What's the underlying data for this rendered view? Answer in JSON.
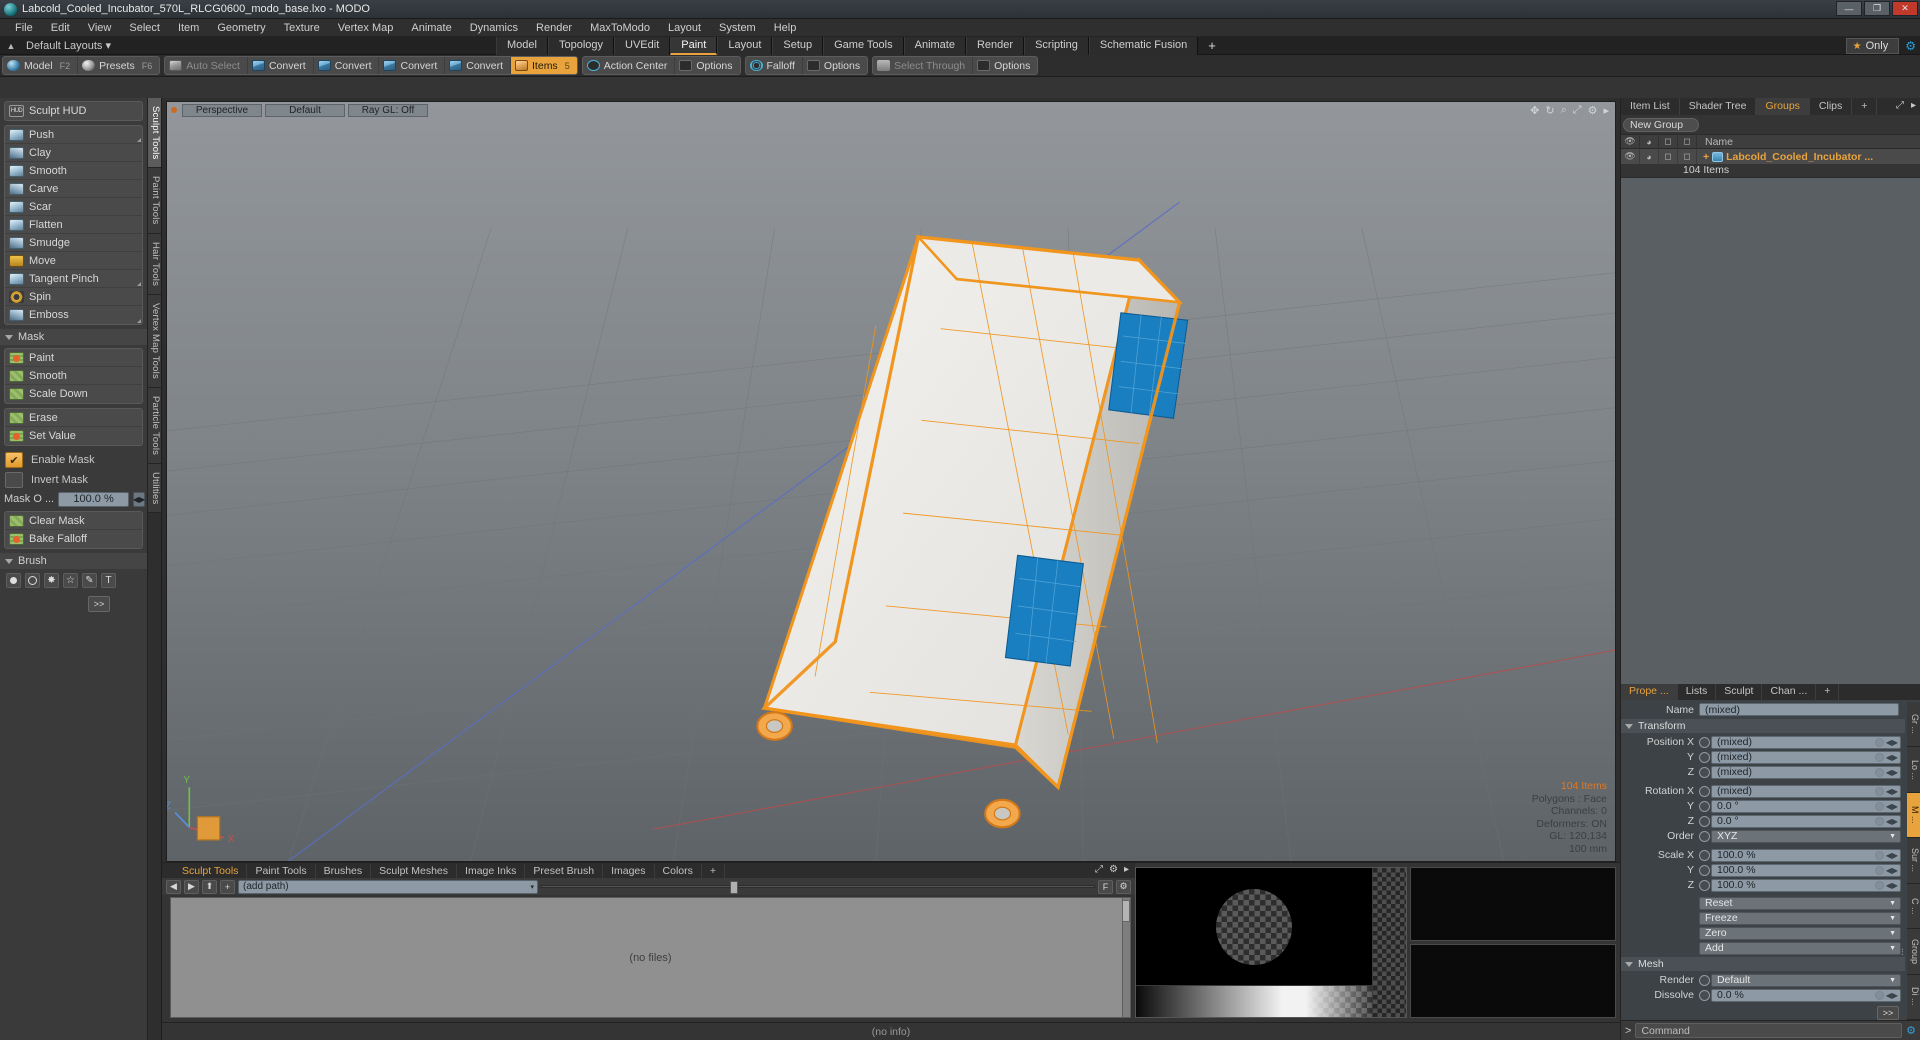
{
  "window": {
    "title": "Labcold_Cooled_Incubator_570L_RLCG0600_modo_base.lxo - MODO",
    "minimize": "—",
    "maximize": "❐",
    "close": "✕"
  },
  "menubar": {
    "items": [
      "File",
      "Edit",
      "View",
      "Select",
      "Item",
      "Geometry",
      "Texture",
      "Vertex Map",
      "Animate",
      "Dynamics",
      "Render",
      "MaxToModo",
      "Layout",
      "System",
      "Help"
    ]
  },
  "layoutbar": {
    "home_icon": "▲",
    "layouts_label": "Default Layouts ▾",
    "tabs": [
      {
        "label": "Model",
        "active": false
      },
      {
        "label": "Topology",
        "active": false
      },
      {
        "label": "UVEdit",
        "active": false
      },
      {
        "label": "Paint",
        "active": true
      },
      {
        "label": "Layout",
        "active": false
      },
      {
        "label": "Setup",
        "active": false
      },
      {
        "label": "Game Tools",
        "active": false
      },
      {
        "label": "Animate",
        "active": false
      },
      {
        "label": "Render",
        "active": false
      },
      {
        "label": "Scripting",
        "active": false
      },
      {
        "label": "Schematic Fusion",
        "active": false
      }
    ],
    "add_tab": "+",
    "only_label": "Only",
    "star_icon": "★",
    "gear_icon": "⚙"
  },
  "modebar": {
    "groups": [
      {
        "buttons": [
          {
            "label": "Model",
            "key": "F2",
            "icon": "sphere-icon",
            "state": "normal"
          },
          {
            "label": "Presets",
            "key": "F6",
            "icon": "presets-icon",
            "state": "normal"
          }
        ]
      },
      {
        "buttons": [
          {
            "label": "Auto Select",
            "key": "",
            "icon": "cube-gray-icon",
            "state": "dim"
          },
          {
            "label": "Convert",
            "key": "",
            "icon": "cube-icon",
            "state": "normal"
          },
          {
            "label": "Convert",
            "key": "",
            "icon": "cube-icon",
            "state": "normal"
          },
          {
            "label": "Convert",
            "key": "",
            "icon": "cube-icon",
            "state": "normal"
          },
          {
            "label": "Convert",
            "key": "",
            "icon": "cube-icon",
            "state": "normal"
          },
          {
            "label": "Items",
            "key": "5",
            "icon": "cube-orange-icon",
            "state": "active"
          }
        ]
      },
      {
        "buttons": [
          {
            "label": "Action Center",
            "key": "",
            "icon": "target-icon",
            "state": "normal"
          },
          {
            "label": "Options",
            "key": "",
            "icon": "checkbox-icon",
            "state": "normal"
          }
        ]
      },
      {
        "buttons": [
          {
            "label": "Falloff",
            "key": "",
            "icon": "falloff-icon",
            "state": "normal"
          },
          {
            "label": "Options",
            "key": "",
            "icon": "checkbox-icon",
            "state": "normal"
          }
        ]
      },
      {
        "buttons": [
          {
            "label": "Select Through",
            "key": "",
            "icon": "people-icon",
            "state": "dim"
          },
          {
            "label": "Options",
            "key": "",
            "icon": "checkbox-icon",
            "state": "normal"
          }
        ]
      }
    ]
  },
  "left_panel": {
    "hud": {
      "label": "Sculpt HUD",
      "icon": "hud-icon"
    },
    "sculpt_tools": [
      {
        "label": "Push",
        "icon": "brush-push-icon",
        "corner": true
      },
      {
        "label": "Clay",
        "icon": "brush-clay-icon",
        "corner": false
      },
      {
        "label": "Smooth",
        "icon": "brush-smooth-icon",
        "corner": false
      },
      {
        "label": "Carve",
        "icon": "brush-carve-icon",
        "corner": false
      },
      {
        "label": "Scar",
        "icon": "brush-scar-icon",
        "corner": false
      },
      {
        "label": "Flatten",
        "icon": "brush-flatten-icon",
        "corner": false
      },
      {
        "label": "Smudge",
        "icon": "brush-smudge-icon",
        "corner": false
      },
      {
        "label": "Move",
        "icon": "brush-move-icon",
        "corner": false
      },
      {
        "label": "Tangent Pinch",
        "icon": "brush-tangent-pinch-icon",
        "corner": true
      },
      {
        "label": "Spin",
        "icon": "brush-spin-icon",
        "corner": false
      },
      {
        "label": "Emboss",
        "icon": "brush-emboss-icon",
        "corner": true
      }
    ],
    "mask_section": "Mask",
    "mask_tools": [
      {
        "label": "Paint",
        "icon": "mask-paint-icon"
      },
      {
        "label": "Smooth",
        "icon": "mask-smooth-icon"
      },
      {
        "label": "Scale Down",
        "icon": "mask-scale-down-icon"
      }
    ],
    "mask_tools2": [
      {
        "label": "Erase",
        "icon": "mask-erase-icon"
      },
      {
        "label": "Set Value",
        "icon": "mask-set-value-icon"
      }
    ],
    "enable_mask": {
      "label": "Enable Mask",
      "checked": true,
      "check_glyph": "✔"
    },
    "invert_mask": {
      "label": "Invert Mask",
      "checked": false
    },
    "mask_opacity": {
      "label": "Mask O  ...",
      "value": "100.0 %",
      "spin": "◀▶"
    },
    "mask_actions": [
      {
        "label": "Clear Mask",
        "icon": "mask-clear-icon"
      },
      {
        "label": "Bake Falloff",
        "icon": "mask-bake-icon"
      }
    ],
    "brush_section": "Brush",
    "brush_icons": [
      "brush-dot-icon",
      "brush-ring-icon",
      "brush-spray-icon",
      "brush-star-icon",
      "brush-pen-icon",
      "brush-text-icon"
    ],
    "more_button": ">>",
    "vtabs": [
      {
        "label": "Sculpt Tools",
        "active": true
      },
      {
        "label": "Paint Tools",
        "active": false
      },
      {
        "label": "Hair Tools",
        "active": false
      },
      {
        "label": "Vertex Map Tools",
        "active": false
      },
      {
        "label": "Particle Tools",
        "active": false
      },
      {
        "label": "Utilities",
        "active": false
      }
    ]
  },
  "viewport": {
    "dropdowns": [
      "Perspective",
      "Default",
      "Ray GL: Off"
    ],
    "tool_icons": [
      "pan-icon",
      "rotate-icon",
      "zoom-icon",
      "fit-icon",
      "gear-icon",
      "chevron-right-icon"
    ],
    "stats": [
      {
        "text": "104 Items",
        "accent": true
      },
      {
        "text": "Polygons : Face",
        "accent": false
      },
      {
        "text": "Channels: 0",
        "accent": false
      },
      {
        "text": "Deformers: ON",
        "accent": false
      },
      {
        "text": "GL: 120,134",
        "accent": false
      },
      {
        "text": "100 mm",
        "accent": false
      }
    ],
    "axis_labels": {
      "x": "X",
      "y": "Y",
      "z": "Z"
    }
  },
  "bottom_panel": {
    "tabs": [
      {
        "label": "Sculpt Tools",
        "active": true
      },
      {
        "label": "Paint Tools",
        "active": false
      },
      {
        "label": "Brushes",
        "active": false
      },
      {
        "label": "Sculpt Meshes",
        "active": false
      },
      {
        "label": "Image Inks",
        "active": false
      },
      {
        "label": "Preset Brush",
        "active": false
      },
      {
        "label": "Images",
        "active": false
      },
      {
        "label": "Colors",
        "active": false
      },
      {
        "label": "+",
        "active": false
      }
    ],
    "tab_tools": [
      "expand-icon",
      "gear-icon",
      "chevron-right-icon"
    ],
    "nav_back": "◀",
    "nav_fwd": "▶",
    "nav_up": "⬆",
    "nav_add": "+",
    "path_value": "(add path)",
    "path_caret": "▾",
    "file_btn_f": "F",
    "file_btn_gear": "⚙",
    "empty_label": "(no files)",
    "status": "(no info)"
  },
  "right_panel": {
    "tabs": [
      {
        "label": "Item List",
        "active": false
      },
      {
        "label": "Shader Tree",
        "active": false
      },
      {
        "label": "Groups",
        "active": true
      },
      {
        "label": "Clips",
        "active": false
      },
      {
        "label": "+",
        "active": false
      }
    ],
    "tab_tools": [
      "expand-icon",
      "chevron-right-icon"
    ],
    "new_group_button": "New Group",
    "columns": [
      "eye-icon",
      "render-icon",
      "wire-icon",
      "shade-icon",
      "Name"
    ],
    "group_row": {
      "expand": "+",
      "icon": "group-item-icon",
      "name": "Labcold_Cooled_Incubator ...",
      "sublabel": "104 Items"
    },
    "property_tabs": [
      {
        "label": "Prope ...",
        "active": true
      },
      {
        "label": "Lists",
        "active": false
      },
      {
        "label": "Sculpt",
        "active": false
      },
      {
        "label": "Chan ...",
        "active": false
      },
      {
        "label": "+",
        "active": false
      }
    ],
    "name_label": "Name",
    "name_value": "(mixed)",
    "transform_section": "Transform",
    "transform_rows": [
      {
        "label": "Position X",
        "value": "(mixed)",
        "type": "field"
      },
      {
        "label": "Y",
        "value": "(mixed)",
        "type": "field"
      },
      {
        "label": "Z",
        "value": "(mixed)",
        "type": "field"
      },
      {
        "label": "Rotation X",
        "value": "(mixed)",
        "type": "field"
      },
      {
        "label": "Y",
        "value": "0.0 °",
        "type": "field"
      },
      {
        "label": "Z",
        "value": "0.0 °",
        "type": "field"
      },
      {
        "label": "Order",
        "value": "XYZ",
        "type": "dropdown"
      },
      {
        "label": "Scale X",
        "value": "100.0 %",
        "type": "field"
      },
      {
        "label": "Y",
        "value": "100.0 %",
        "type": "field"
      },
      {
        "label": "Z",
        "value": "100.0 %",
        "type": "field"
      }
    ],
    "action_rows": [
      {
        "label": "Reset",
        "type": "dropdown"
      },
      {
        "label": "Freeze",
        "type": "dropdown"
      },
      {
        "label": "Zero",
        "type": "dropdown"
      },
      {
        "label": "Add",
        "type": "dropdown"
      }
    ],
    "mesh_section": "Mesh",
    "mesh_rows": [
      {
        "label": "Render",
        "value": "Default",
        "type": "dropdown"
      },
      {
        "label": "Dissolve",
        "value": "0.0 %",
        "type": "field"
      }
    ],
    "more_button": ">>",
    "vtabs": [
      {
        "label": "Gr ...",
        "active": false
      },
      {
        "label": "Lo ...",
        "active": false
      },
      {
        "label": "M ...",
        "active": true
      },
      {
        "label": "Sur ...",
        "active": false
      },
      {
        "label": "C ...",
        "active": false
      },
      {
        "label": "Group ...",
        "active": false
      },
      {
        "label": "Di ...",
        "active": false
      }
    ],
    "command": {
      "prompt": ">",
      "placeholder": "Command",
      "gear": "⚙"
    }
  },
  "colors": {
    "accent": "#e8a33d",
    "selection": "#f0951e",
    "panel_bg": "#3a3a3a",
    "viewport_top": "#8e9296",
    "model_blue": "#1a7fc1"
  }
}
